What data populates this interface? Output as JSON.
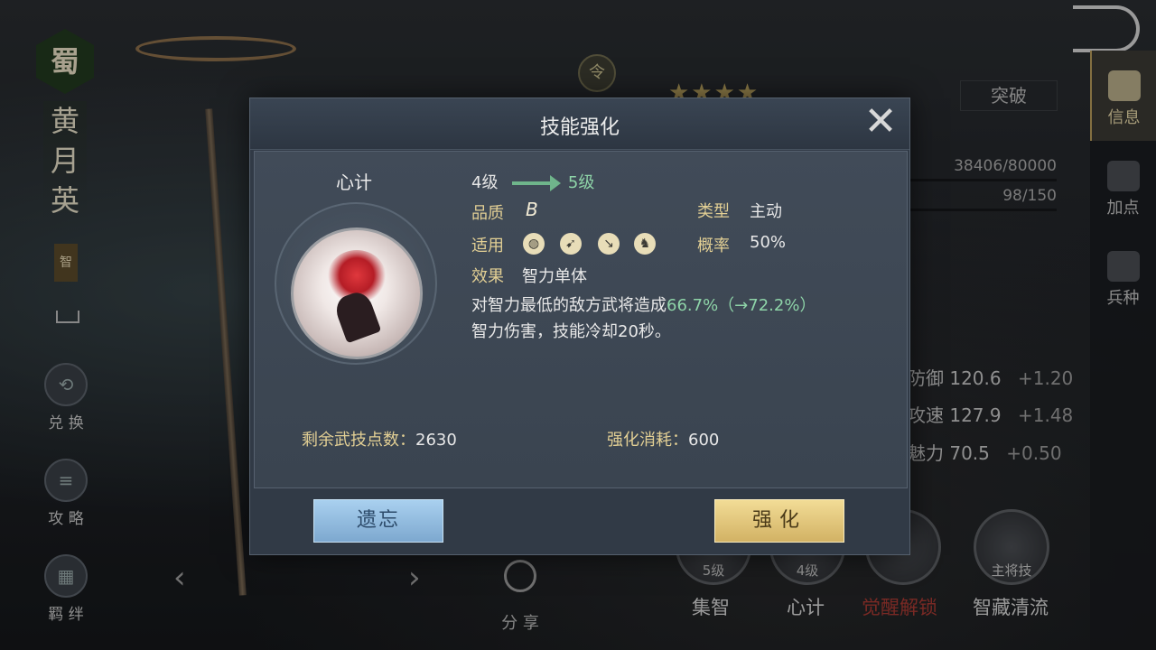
{
  "hero": {
    "faction": "蜀",
    "name": "黄月英",
    "attribute": "智"
  },
  "left_menu": [
    {
      "label": "兑 换",
      "icon": "exchange-icon"
    },
    {
      "label": "攻 略",
      "icon": "scroll-icon"
    },
    {
      "label": "羁 绊",
      "icon": "bond-icon"
    }
  ],
  "background": {
    "order_badge": "令",
    "stars": "★★★★",
    "breakthrough_button": "突破",
    "exp": "38406/80000",
    "stamina": "98/150",
    "stats": [
      {
        "label": "防御",
        "value": "120.6",
        "plus": "+1.20"
      },
      {
        "label": "攻速",
        "value": "127.9",
        "plus": "+1.48"
      },
      {
        "label": "魅力",
        "value": "70.5",
        "plus": "+0.50"
      }
    ],
    "skills": [
      {
        "name": "集智",
        "level": "5级"
      },
      {
        "name": "心计",
        "level": "4级"
      },
      {
        "name": "觉醒解锁",
        "level": ""
      },
      {
        "name": "智藏清流",
        "level": "主将技"
      }
    ],
    "share_label": "分 享"
  },
  "right_tabs": [
    {
      "label": "信息",
      "icon": "info-scroll-icon",
      "active": true
    },
    {
      "label": "加点",
      "icon": "add-point-icon",
      "active": false
    },
    {
      "label": "兵种",
      "icon": "troop-icon",
      "active": false
    }
  ],
  "modal": {
    "title": "技能强化",
    "skill_name": "心计",
    "level_from": "4级",
    "level_to": "5级",
    "quality_label": "品质",
    "quality_value": "B",
    "type_label": "类型",
    "type_value": "主动",
    "applicable_label": "适用",
    "weapons": [
      "shield-icon",
      "bow-icon",
      "spear-icon",
      "horse-icon"
    ],
    "rate_label": "概率",
    "rate_value": "50%",
    "effect_label": "效果",
    "effect_value": "智力单体",
    "desc_prefix": "对智力最低的敌方武将造成",
    "desc_highlight": "66.7%（→72.2%）",
    "desc_suffix": "智力伤害，技能冷却20秒。",
    "remaining_label": "剩余武技点数：",
    "remaining_value": "2630",
    "cost_label": "强化消耗：",
    "cost_value": "600",
    "forget_button": "遗忘",
    "enhance_button": "强化"
  },
  "colors": {
    "highlight_green": "#8ed4a8",
    "label_gold": "#e2cf94",
    "forget_blue": "#a9d0ef",
    "enhance_gold": "#f2dc96"
  }
}
